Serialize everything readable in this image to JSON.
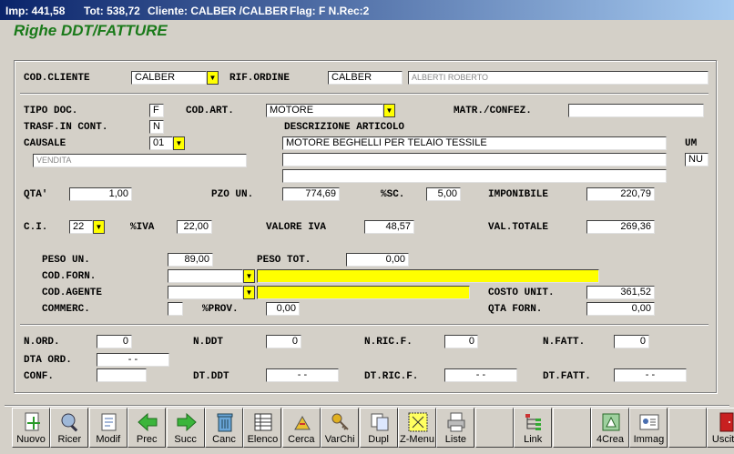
{
  "titlebar": {
    "imp": "Imp: 441,58",
    "tot": "Tot: 538,72",
    "cliente": "Cliente: CALBER  /CALBER",
    "flag": "Flag: F  N.Rec:2"
  },
  "heading": "Righe DDT/FATTURE",
  "labels": {
    "cod_cliente": "COD.CLIENTE",
    "rif_ordine": "RIF.ORDINE",
    "tipo_doc": "TIPO DOC.",
    "cod_art": "COD.ART.",
    "matr_confez": "MATR./CONFEZ.",
    "trasf_in_cont": "TRASF.IN CONT.",
    "descrizione_articolo": "DESCRIZIONE ARTICOLO",
    "causale": "CAUSALE",
    "um": "UM",
    "qta": "QTA'",
    "pzo_un": "PZO UN.",
    "sc": "%SC.",
    "imponibile": "IMPONIBILE",
    "ci": "C.I.",
    "iva": "%IVA",
    "valore_iva": "VALORE IVA",
    "val_totale": "VAL.TOTALE",
    "peso_un": "PESO UN.",
    "peso_tot": "PESO TOT.",
    "cod_forn": "COD.FORN.",
    "cod_agente": "COD.AGENTE",
    "costo_unit": "COSTO UNIT.",
    "commerc": "COMMERC.",
    "prov": "%PROV.",
    "qta_forn": "QTA FORN.",
    "n_ord": "N.ORD.",
    "n_ddt": "N.DDT",
    "n_ric_f": "N.RIC.F.",
    "n_fatt": "N.FATT.",
    "dta_ord": "DTA ORD.",
    "conf": "CONF.",
    "dt_ddt": "DT.DDT",
    "dt_ric_f": "DT.RIC.F.",
    "dt_fatt": "DT.FATT."
  },
  "values": {
    "cod_cliente": "CALBER",
    "rif_ordine": "CALBER",
    "rif_ordine_name": "ALBERTI ROBERTO",
    "tipo_doc": "F",
    "cod_art": "MOTORE",
    "matr_confez": "",
    "trasf_in_cont": "N",
    "causale": "01",
    "causale_desc": "VENDITA",
    "descr1": "MOTORE BEGHELLI PER TELAIO TESSILE",
    "descr2": "",
    "descr3": "",
    "um": "NU",
    "qta": "1,00",
    "pzo_un": "774,69",
    "sc": "5,00",
    "imponibile": "220,79",
    "ci": "22",
    "iva": "22,00",
    "valore_iva": "48,57",
    "val_totale": "269,36",
    "peso_un": "89,00",
    "peso_tot": "0,00",
    "cod_forn": "",
    "cod_forn_desc": "",
    "cod_agente": "",
    "cod_agente_desc": "",
    "costo_unit": "361,52",
    "commerc": "",
    "prov": "0,00",
    "qta_forn": "0,00",
    "n_ord": "0",
    "n_ddt": "0",
    "n_ric_f": "0",
    "n_fatt": "0",
    "dta_ord": "-  -",
    "conf": "",
    "dt_ddt": "-  -",
    "dt_ric_f": "-  -",
    "dt_fatt": "-  -"
  },
  "toolbar": [
    {
      "label": "Nuovo",
      "icon": "new-doc-icon"
    },
    {
      "label": "Ricer",
      "icon": "search-icon"
    },
    {
      "label": "Modif",
      "icon": "edit-icon"
    },
    {
      "label": "Prec",
      "icon": "arrow-left-icon"
    },
    {
      "label": "Succ",
      "icon": "arrow-right-icon"
    },
    {
      "label": "Canc",
      "icon": "trash-icon"
    },
    {
      "label": "Elenco",
      "icon": "list-icon"
    },
    {
      "label": "Cerca",
      "icon": "find-icon"
    },
    {
      "label": "VarChi",
      "icon": "keys-icon"
    },
    {
      "label": "Dupl",
      "icon": "duplicate-icon"
    },
    {
      "label": "Z-Menu",
      "icon": "menu-icon"
    },
    {
      "label": "Liste",
      "icon": "printer-icon"
    },
    {
      "label": "",
      "icon": "blank-icon"
    },
    {
      "label": "Link",
      "icon": "link-icon"
    },
    {
      "label": "",
      "icon": "blank-icon"
    },
    {
      "label": "4Crea",
      "icon": "create-icon"
    },
    {
      "label": "Immag",
      "icon": "image-icon"
    },
    {
      "label": "",
      "icon": "blank-icon"
    },
    {
      "label": "Uscita",
      "icon": "exit-door-icon"
    }
  ],
  "colors": {
    "heading": "#1a7a1a",
    "titlebar_start": "#0a246a",
    "dropdown": "#ffff00"
  }
}
